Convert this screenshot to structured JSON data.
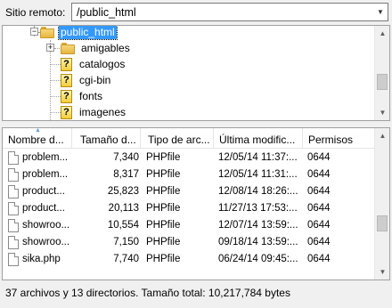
{
  "remote": {
    "label": "Sitio remoto:",
    "path": "/public_html"
  },
  "tree": {
    "root": "public_html",
    "children": [
      "amigables",
      "catalogos",
      "cgi-bin",
      "fonts",
      "imagenes"
    ]
  },
  "files": {
    "columns": [
      "Nombre d...",
      "Tamaño d...",
      "Tipo de arc...",
      "Última modific...",
      "Permisos"
    ],
    "rows": [
      {
        "name": "problem...",
        "size": "7,340",
        "type": "PHPfile",
        "modified": "12/05/14 11:37:...",
        "perms": "0644"
      },
      {
        "name": "problem...",
        "size": "8,317",
        "type": "PHPfile",
        "modified": "12/05/14 11:31:...",
        "perms": "0644"
      },
      {
        "name": "product...",
        "size": "25,823",
        "type": "PHPfile",
        "modified": "12/08/14 18:26:...",
        "perms": "0644"
      },
      {
        "name": "product...",
        "size": "20,113",
        "type": "PHPfile",
        "modified": "11/27/13 17:53:...",
        "perms": "0644"
      },
      {
        "name": "showroo...",
        "size": "10,554",
        "type": "PHPfile",
        "modified": "12/07/14 13:59:...",
        "perms": "0644"
      },
      {
        "name": "showroo...",
        "size": "7,150",
        "type": "PHPfile",
        "modified": "09/18/14 13:59:...",
        "perms": "0644"
      },
      {
        "name": "sika.php",
        "size": "7,740",
        "type": "PHPfile",
        "modified": "06/24/14 09:45:...",
        "perms": "0644"
      }
    ]
  },
  "status": {
    "text": "37 archivos y 13 directorios. Tamaño total: 10,217,784 bytes"
  },
  "icons": {
    "folder": "folder-icon",
    "unknown": "question-folder-icon",
    "file": "file-icon",
    "dropdown": "chevron-down-icon"
  }
}
